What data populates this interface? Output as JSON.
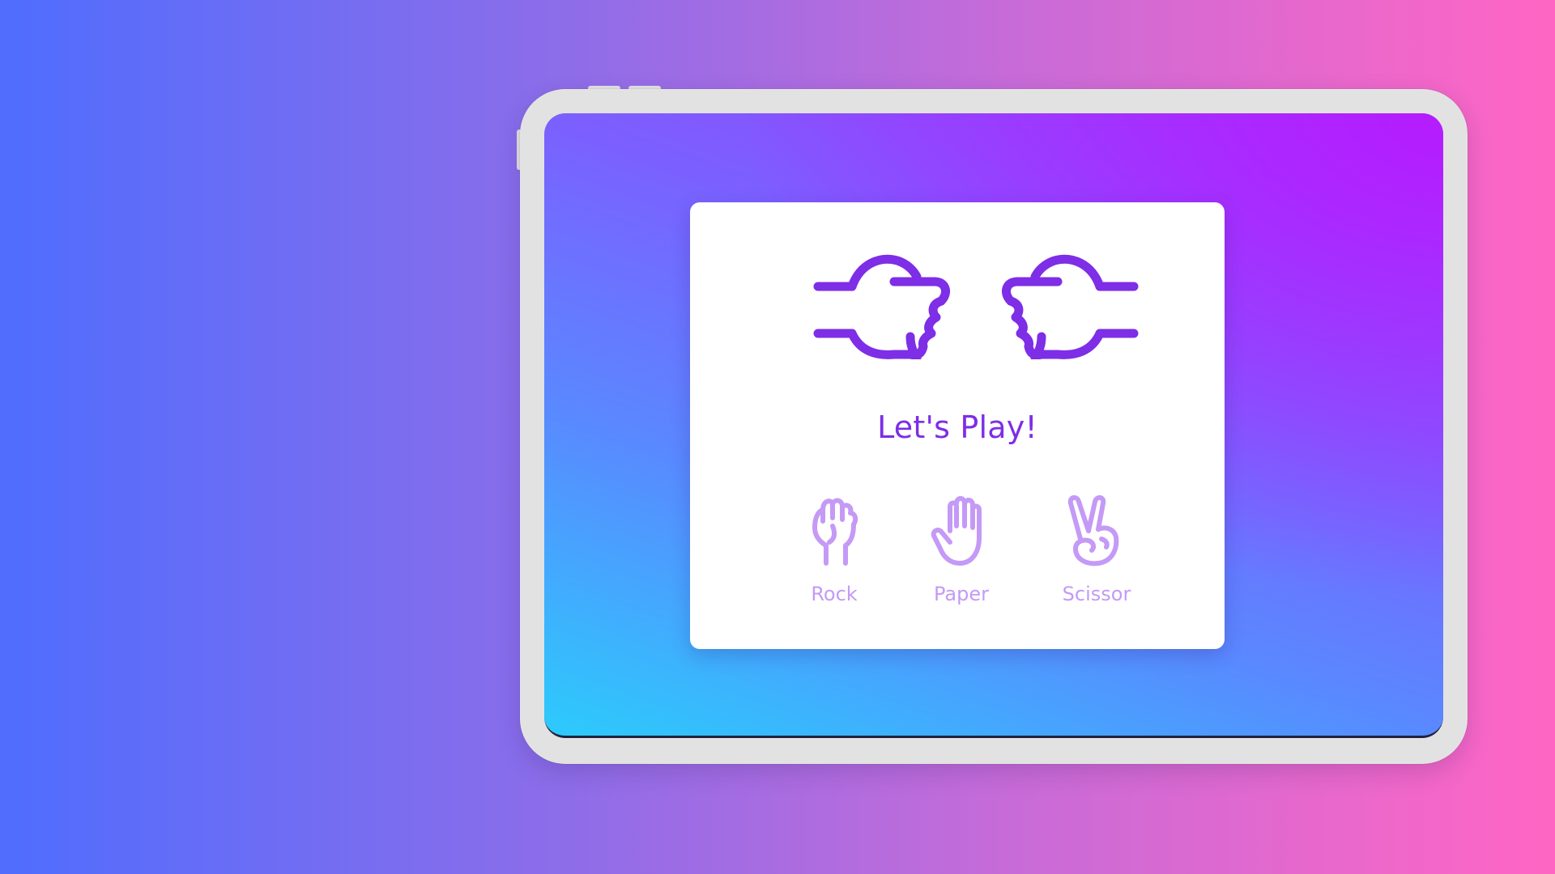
{
  "game": {
    "title": "Let's Play!",
    "choices": [
      {
        "label": "Rock",
        "icon": "rock-hand-icon"
      },
      {
        "label": "Paper",
        "icon": "paper-hand-icon"
      },
      {
        "label": "Scissor",
        "icon": "scissor-hand-icon"
      }
    ],
    "player_hand_icon": "fist-hand-icon",
    "computer_hand_icon": "fist-hand-icon"
  },
  "colors": {
    "accent": "#7d2ee6",
    "choice": "#c49af6",
    "background_left": "#4f6dfe",
    "background_right": "#ff66c4",
    "screen_top": "#b021ff",
    "screen_bottom": "#28c8fb",
    "frame": "#e2e2e2"
  }
}
